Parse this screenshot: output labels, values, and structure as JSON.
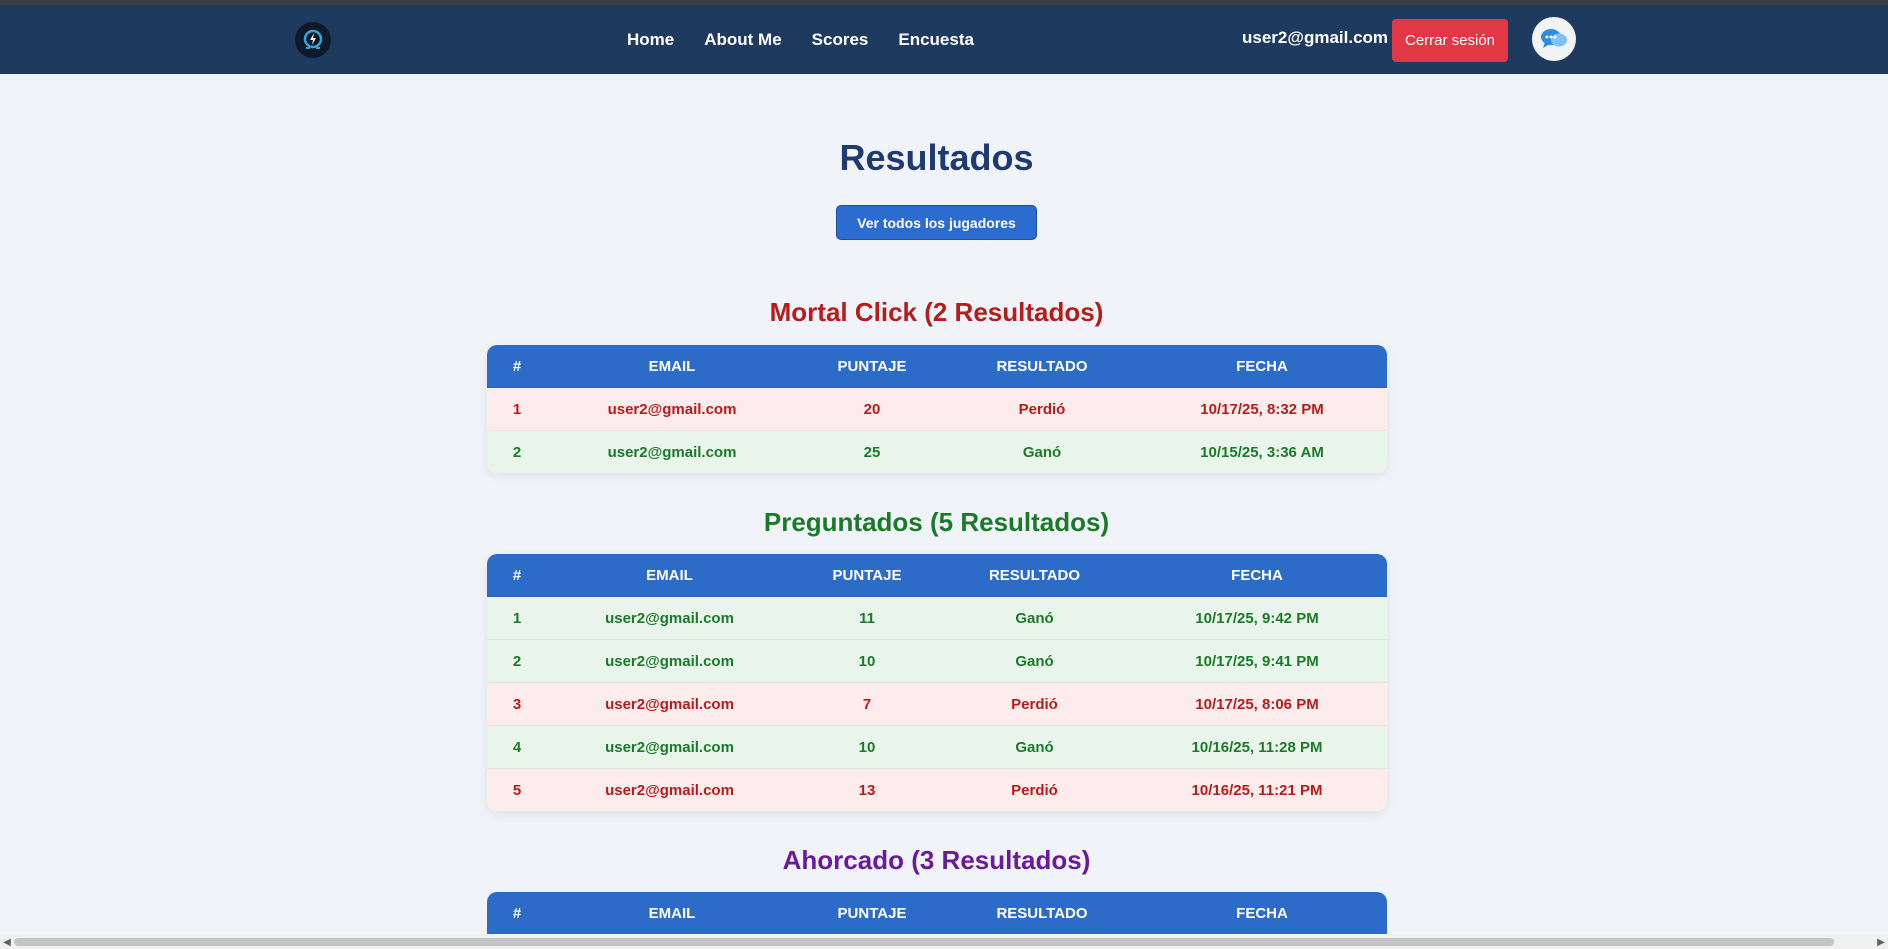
{
  "nav": {
    "links": [
      "Home",
      "About Me",
      "Scores",
      "Encuesta"
    ],
    "user_email": "user2@gmail.com",
    "logout_label": "Cerrar sesión"
  },
  "page": {
    "title": "Resultados",
    "all_players_label": "Ver todos los jugadores"
  },
  "columns": [
    "#",
    "EMAIL",
    "PUNTAJE",
    "RESULTADO",
    "FECHA"
  ],
  "sections": [
    {
      "title": "Mortal Click (2 Resultados)",
      "color": "#b71c1c",
      "rows": [
        {
          "n": "1",
          "email": "user2@gmail.com",
          "score": "20",
          "result": "Perdió",
          "date": "10/17/25, 8:32 PM",
          "status": "lost"
        },
        {
          "n": "2",
          "email": "user2@gmail.com",
          "score": "25",
          "result": "Ganó",
          "date": "10/15/25, 3:36 AM",
          "status": "won"
        }
      ]
    },
    {
      "title": "Preguntados (5 Resultados)",
      "color": "#1b7a2a",
      "rows": [
        {
          "n": "1",
          "email": "user2@gmail.com",
          "score": "11",
          "result": "Ganó",
          "date": "10/17/25, 9:42 PM",
          "status": "won"
        },
        {
          "n": "2",
          "email": "user2@gmail.com",
          "score": "10",
          "result": "Ganó",
          "date": "10/17/25, 9:41 PM",
          "status": "won"
        },
        {
          "n": "3",
          "email": "user2@gmail.com",
          "score": "7",
          "result": "Perdió",
          "date": "10/17/25, 8:06 PM",
          "status": "lost"
        },
        {
          "n": "4",
          "email": "user2@gmail.com",
          "score": "10",
          "result": "Ganó",
          "date": "10/16/25, 11:28 PM",
          "status": "won"
        },
        {
          "n": "5",
          "email": "user2@gmail.com",
          "score": "13",
          "result": "Perdió",
          "date": "10/16/25, 11:21 PM",
          "status": "lost"
        }
      ]
    },
    {
      "title": "Ahorcado (3 Resultados)",
      "color": "#6a1b9a",
      "rows": []
    }
  ]
}
